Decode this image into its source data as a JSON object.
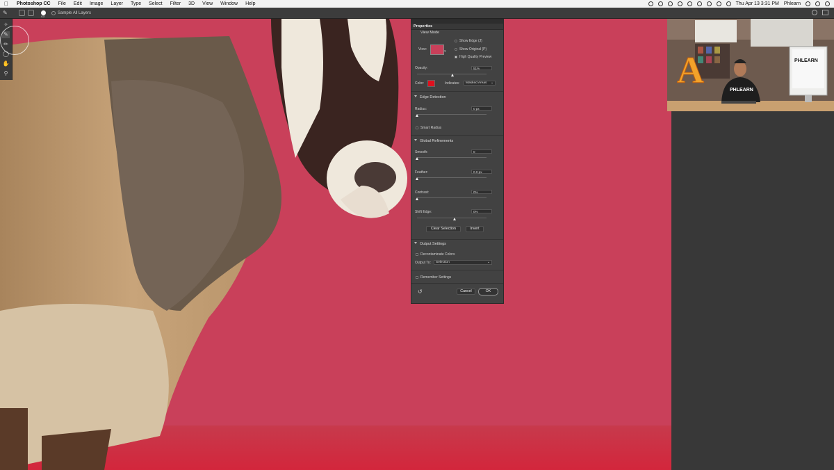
{
  "menubar": {
    "app": "Photoshop CC",
    "menus": [
      "File",
      "Edit",
      "Image",
      "Layer",
      "Type",
      "Select",
      "Filter",
      "3D",
      "View",
      "Window",
      "Help"
    ],
    "clock": "Thu Apr 13  3:31 PM",
    "user": "Phlearn"
  },
  "options": {
    "brush_size": "43",
    "sample_all_layers": "Sample All Layers"
  },
  "props": {
    "tab": "Properties",
    "view_mode": {
      "heading": "View Mode",
      "view_label": "View:",
      "show_edge": "Show Edge (J)",
      "show_original": "Show Original (P)",
      "high_quality": "High Quality Preview"
    },
    "opacity": {
      "label": "Opacity:",
      "value": "51%",
      "level": 0.51
    },
    "color": {
      "label": "Color:",
      "swatch": "#e0101e",
      "indicates_label": "Indicates:",
      "indicates_value": "Masked Areas"
    },
    "edge_detection": {
      "heading": "Edge Detection",
      "radius_label": "Radius:",
      "radius_value": "0 px",
      "smart_radius": "Smart Radius"
    },
    "global_refinements": {
      "heading": "Global Refinements",
      "smooth_label": "Smooth:",
      "smooth_value": "0",
      "feather_label": "Feather:",
      "feather_value": "0.0 px",
      "contrast_label": "Contrast:",
      "contrast_value": "0%",
      "shift_label": "Shift Edge:",
      "shift_value": "0%",
      "clear_selection": "Clear Selection",
      "invert": "Invert"
    },
    "output_settings": {
      "heading": "Output Settings",
      "decontaminate": "Decontaminate Colors",
      "output_label": "Output To:",
      "output_value": "Selection",
      "remember": "Remember Settings"
    },
    "cancel": "Cancel",
    "ok": "OK"
  },
  "webcam": {
    "shirt_text": "PHLEARN",
    "monitor_text": "PHLEARN",
    "sign_letter": "A"
  },
  "colors": {
    "overlay_red": "#c9405a",
    "panel": "#424242"
  }
}
